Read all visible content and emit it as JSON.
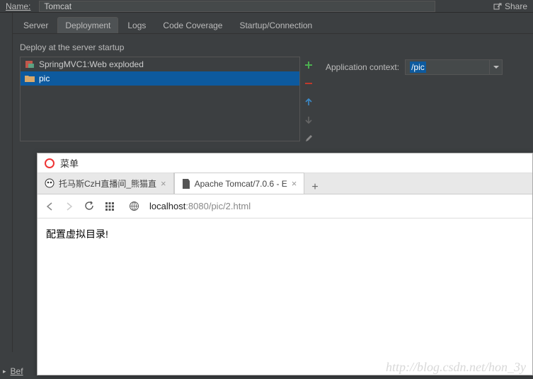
{
  "topbar": {
    "name_label": "Name:",
    "name_value": "Tomcat",
    "share_label": "Share"
  },
  "tabs": [
    "Server",
    "Deployment",
    "Logs",
    "Code Coverage",
    "Startup/Connection"
  ],
  "active_tab_index": 1,
  "deploy": {
    "section_label": "Deploy at the server startup",
    "artifacts": [
      {
        "icon": "archive-icon",
        "label": "SpringMVC1:Web exploded",
        "selected": false
      },
      {
        "icon": "folder-icon",
        "label": "pic",
        "selected": true
      }
    ],
    "context_label": "Application context:",
    "context_value": "/pic"
  },
  "browser": {
    "menu_label": "菜单",
    "tabs": [
      {
        "label": "托马斯CzH直播间_熊猫直",
        "active": false
      },
      {
        "label": "Apache Tomcat/7.0.6 - E",
        "active": true
      }
    ],
    "url_host": "localhost",
    "url_path": ":8080/pic/2.html",
    "page_text": "配置虚拟目录!"
  },
  "bottom": {
    "label": "Bef"
  },
  "watermark": "http://blog.csdn.net/hon_3y"
}
